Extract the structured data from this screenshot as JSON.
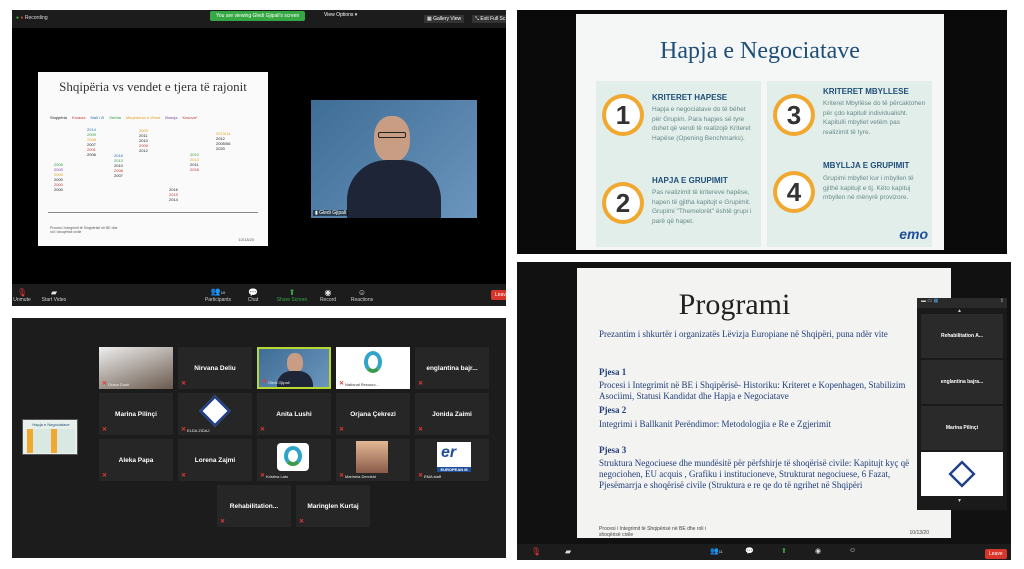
{
  "top_left": {
    "recording_label": "Recording",
    "viewing_banner": "You are viewing Gledi Gjipali's screen",
    "view_options": "View Options",
    "gallery_view": "Gallery View",
    "exit_full": "Exit Full Sc",
    "slide": {
      "title": "Shqipëria vs vendet e tjera të rajonit",
      "countries": [
        "Shqipëria",
        "Kroacia",
        "Mali i Zi",
        "Serbia",
        "Maqedonia e Veriut",
        "Bosnja",
        "Kosova*"
      ],
      "col_albania": [
        "2009",
        "2003",
        "2000",
        "2000",
        "2000",
        "2000"
      ],
      "col_croatia": [
        "2014",
        "2009",
        "2008",
        "2007",
        "2001",
        "2006"
      ],
      "col_montenegro": [
        "2016",
        "2013",
        "2010",
        "2008",
        "2007"
      ],
      "col_serbia": [
        "2009",
        "2011",
        "2010",
        "2009",
        "2012"
      ],
      "col_macedonia": [
        "2012",
        "2013",
        "2011",
        "2018"
      ],
      "col_bosnia": [
        "2016",
        "2015",
        "2014"
      ],
      "col_kosovo": [
        "2013/14",
        "2012",
        "2005/06",
        "2020"
      ],
      "footer": "Procesi i Integrimit të Shqipërisë në BE dhe roli i shoqërisë civile",
      "date": "10/13/20"
    },
    "speaker_name": "Gledi Gjipali",
    "controls": [
      "Unmute",
      "Start Video",
      "Participants",
      "Chat",
      "Share Screen",
      "Record",
      "Reactions"
    ],
    "participants_count": "10",
    "leave": "Leave"
  },
  "top_right": {
    "title": "Hapja e Negociatave",
    "blocks": [
      {
        "num": "1",
        "heading": "KRITERET HAPESE",
        "text": "Hapja e negociatave do të bëhet për Grupim. Para hapjes së tyre duhet që vendi të realizojë Kriteret Hapëse (Opening Benchmarks)."
      },
      {
        "num": "2",
        "heading": "HAPJA E GRUPIMIT",
        "text": "Pas realizimit të kritereve hapëse, hapen të gjitha kapitujt e Grupimit. Grupimi \"Themelorët\" është grupi i parë që hapet."
      },
      {
        "num": "3",
        "heading": "KRITERET MBYLLESE",
        "text": "Kriteret Mbyllëse do të përcaktohen për çdo kapitull individualisht. Kapitulli mbyllet vetëm pas realizimit të tyre."
      },
      {
        "num": "4",
        "heading": "MBYLLJA E GRUPIMIT",
        "text": "Grupimi mbyllet kur i mbyllen të gjithë kapitujt e tij. Këto kapituj mbyllen në mënyrë provizore."
      }
    ],
    "logo": "emo"
  },
  "bottom_left": {
    "tiles": [
      {
        "name": "",
        "label": "Oraca Dosti"
      },
      {
        "name": "Nirvana Deliu",
        "label": ""
      },
      {
        "name": "",
        "label": "Gledi Gjipali"
      },
      {
        "name": "",
        "label": "National Resourc..."
      },
      {
        "name": "englantina bajr...",
        "label": ""
      },
      {
        "name": "Marina Pilinçi",
        "label": ""
      },
      {
        "name": "",
        "label": "ELDA ZIDAJ"
      },
      {
        "name": "Anita Lushi",
        "label": ""
      },
      {
        "name": "Orjana Çekrezi",
        "label": ""
      },
      {
        "name": "Jonida Zaimi",
        "label": ""
      },
      {
        "name": "Aleka Papa",
        "label": ""
      },
      {
        "name": "Lorena Zajmi",
        "label": ""
      },
      {
        "name": "",
        "label": "Kristina Lato"
      },
      {
        "name": "",
        "label": "Marinela Dervishi"
      },
      {
        "name": "",
        "label": "EMA staff"
      },
      {
        "name": "Rehabilitation...",
        "label": ""
      },
      {
        "name": "Maringlen Kurtaj",
        "label": ""
      }
    ],
    "thumb_title": "Hapja e Negociatave",
    "european_text": "EUROPEAN M"
  },
  "bottom_right": {
    "title": "Programi",
    "intro": "Prezantim i shkurtër i organizatës Lëvizja Europiane në Shqipëri, puna ndër vite",
    "parts": [
      {
        "heading": "Pjesa 1",
        "text": "Procesi i Integrimit në BE i Shqipërisë- Historiku: Kriteret e Kopenhagen, Stabilizim Asociimi, Statusi Kandidat dhe Hapja e Negociatave"
      },
      {
        "heading": "Pjesa 2",
        "text": "Integrimi i Ballkanit Perëndimor: Metodologjia e Re e Zgjerimit"
      },
      {
        "heading": "Pjesa 3",
        "text": "Struktura Negociuese dhe mundësitë për përfshirje të shoqërisë civile: Kapitujt kyç që negociohen, EU acquis , Grafiku i institucioneve, Strukturat negociuese, 6 Fazat, Pjesëmarrja e shoqërisë civile (Struktura e re qe do të ngrihet në Shqipëri"
      }
    ],
    "footer": "Procesi i Integrimit të Shqipërisë në BE dhe roli i shoqërisë civile",
    "date": "10/13/20",
    "side_tiles": [
      "Rehabilitation A...",
      "englantina bajra...",
      "Marina Pilinçi"
    ],
    "participants_count": "11",
    "leave": "Leave"
  }
}
